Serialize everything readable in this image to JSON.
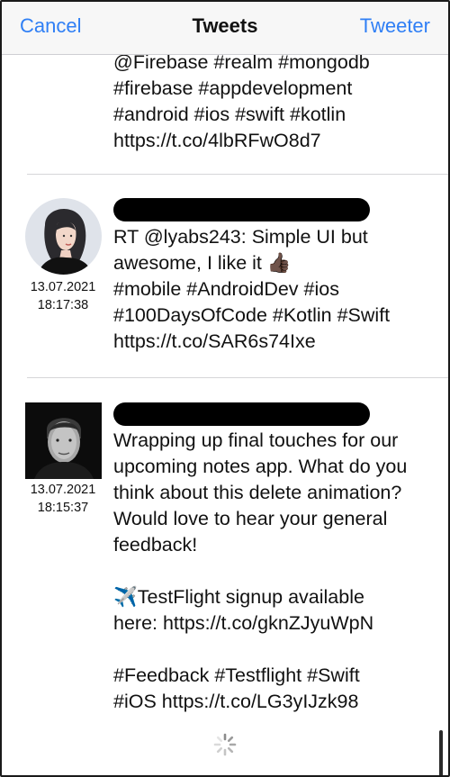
{
  "navbar": {
    "cancel_label": "Cancel",
    "title": "Tweets",
    "tweeter_label": "Tweeter"
  },
  "tweets": [
    {
      "text": "@Firebase #realm #mongodb\n#firebase #appdevelopment\n#android #ios #swift #kotlin\nhttps://t.co/4lbRFwO8d7"
    },
    {
      "avatar": "woman-illustration-avatar",
      "date": "13.07.2021",
      "time": "18:17:38",
      "text": "RT @lyabs243: Simple UI but\nawesome, I like it 👍🏿\n#mobile #AndroidDev #ios\n#100DaysOfCode #Kotlin #Swift\nhttps://t.co/SAR6s74Ixe"
    },
    {
      "avatar": "man-portrait-avatar",
      "date": "13.07.2021",
      "time": "18:15:37",
      "text": "Wrapping up final touches for our\nupcoming notes app. What do you\nthink about this delete animation?\nWould love to hear your general\nfeedback!\n\n✈️TestFlight signup available\nhere: https://t.co/gknZJyuWpN\n\n#Feedback #Testflight #Swift\n#iOS https://t.co/LG3yIJzk98"
    }
  ],
  "colors": {
    "accent": "#2f7ff5",
    "divider": "#d6d6d8",
    "redaction": "#000000"
  },
  "loading_indicator": "spinner-icon"
}
